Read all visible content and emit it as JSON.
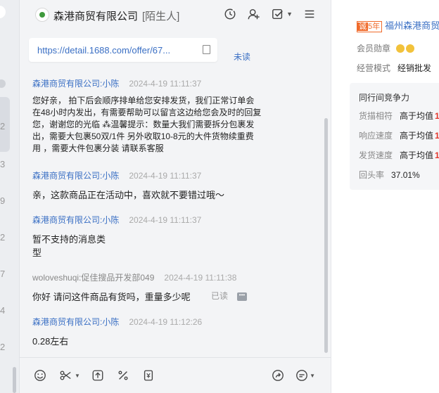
{
  "header": {
    "title": "森港商贸有限公司",
    "tag": "[陌生人]"
  },
  "messages": {
    "link_url": "https://detail.1688.com/offer/67...",
    "link_status": "未读",
    "items": [
      {
        "sender": "森港商贸有限公司:小陈",
        "time": "2024-4-19 11:11:37",
        "lines": [
          "您好亲， 拍下后会顺序排单给您安排发货，我们正常订单会",
          "在48小时内发出，有需要帮助可以留言这边给您会及时的回复",
          "您，谢谢您的光临 ⁂温馨提示：数量大我们需要拆分包裹发",
          "出，需要大包裹50双/1件 另外收取10-8元的大件货物续重费",
          "用 ，需要大件包裹分装 请联系客服"
        ]
      },
      {
        "sender": "森港商贸有限公司:小陈",
        "time": "2024-4-19 11:11:37",
        "lines": [
          "亲，这款商品正在活动中，喜欢就不要错过哦～"
        ]
      },
      {
        "sender": "森港商贸有限公司:小陈",
        "time": "2024-4-19 11:11:37",
        "lines": [
          "暂不支持的消息类",
          "型"
        ]
      },
      {
        "sender": "woloveshuqi:促佳搜品开发部049",
        "time": "2024-4-19 11:11:38",
        "lines": [
          "你好 请问这件商品有货吗，重量多少呢"
        ],
        "status": "已读"
      },
      {
        "sender": "森港商贸有限公司:小陈",
        "time": "2024-4-19 11:12:26",
        "lines": [
          "0.28左右"
        ]
      }
    ]
  },
  "left_strip": {
    "digits": [
      "2",
      "3",
      "9",
      "2",
      "7",
      "4",
      "2"
    ]
  },
  "panel": {
    "years": "5年",
    "years_mark": "诚",
    "shop_name": "福州森港商贸",
    "medal_label": "会员勋章",
    "mode_label": "经营模式",
    "mode_value": "经销批发",
    "compete_title": "同行间竞争力",
    "rows": [
      {
        "label": "货描相符",
        "value": "高于均值",
        "arrow": "1"
      },
      {
        "label": "响应速度",
        "value": "高于均值",
        "arrow": "1"
      },
      {
        "label": "发货速度",
        "value": "高于均值",
        "arrow": "1"
      },
      {
        "label": "回头率",
        "value": "37.01%",
        "arrow": ""
      }
    ]
  }
}
